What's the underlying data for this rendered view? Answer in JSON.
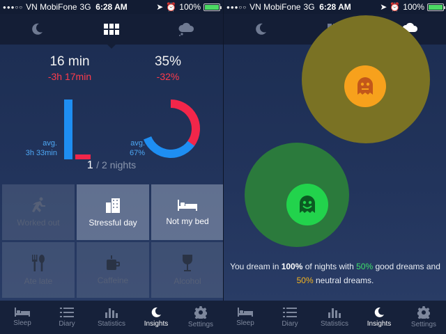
{
  "status": {
    "carrier": "VN MobiFone",
    "network": "3G",
    "time": "6:28 AM",
    "battery": "100%",
    "battery_level": 1.0
  },
  "left": {
    "stat1": {
      "value": "16 min",
      "delta": "-3h 17min"
    },
    "stat2": {
      "value": "35%",
      "delta": "-32%"
    },
    "avg1": {
      "label": "avg.",
      "value": "3h 33min"
    },
    "avg2": {
      "label": "avg.",
      "value": "67%"
    },
    "donut": {
      "avg_fraction": 0.67,
      "value_fraction": 0.35,
      "avg_color": "#1e8ef2",
      "value_color": "#f2264a"
    },
    "nights": {
      "count": "1",
      "total": "/ 2 nights"
    },
    "tags": [
      {
        "label": "Worked out",
        "icon": "running-icon",
        "selected": false
      },
      {
        "label": "Stressful day",
        "icon": "office-building-icon",
        "selected": true
      },
      {
        "label": "Not my bed",
        "icon": "bed-icon",
        "selected": true
      },
      {
        "label": "Ate late",
        "icon": "cutlery-icon",
        "selected": false
      },
      {
        "label": "Caffeine",
        "icon": "coffee-cup-icon",
        "selected": false
      },
      {
        "label": "Alcohol",
        "icon": "wine-glass-icon",
        "selected": false
      }
    ]
  },
  "right": {
    "summary": {
      "p1": "You dream in ",
      "pct_all": "100%",
      "p2": " of nights with ",
      "pct_good": "50%",
      "p3": " good dreams and ",
      "pct_neutral": "50%",
      "p4": " neutral dreams."
    },
    "colors": {
      "neutral": "#f7a11c",
      "good": "#22d34c"
    }
  },
  "bottom_nav": [
    {
      "label": "Sleep",
      "icon": "bed-icon"
    },
    {
      "label": "Diary",
      "icon": "list-icon"
    },
    {
      "label": "Statistics",
      "icon": "bar-chart-icon"
    },
    {
      "label": "Insights",
      "icon": "moon-icon"
    },
    {
      "label": "Settings",
      "icon": "gear-icon"
    }
  ],
  "active_tab": "Insights"
}
